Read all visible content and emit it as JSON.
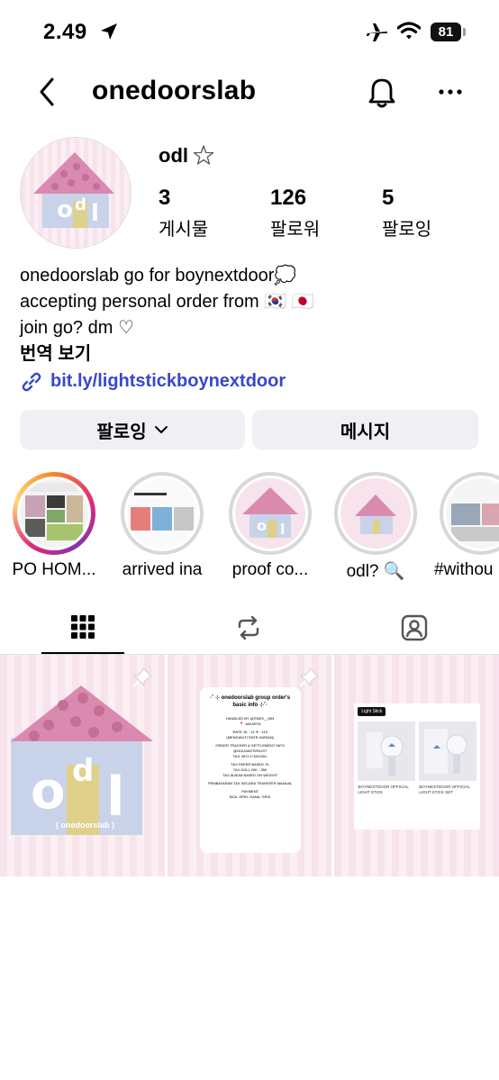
{
  "status_bar": {
    "time": "2.49",
    "battery": "81"
  },
  "header": {
    "username": "onedoorslab"
  },
  "profile": {
    "display_name": "odl",
    "stats": [
      {
        "value": "3",
        "label": "게시물"
      },
      {
        "value": "126",
        "label": "팔로워"
      },
      {
        "value": "5",
        "label": "팔로잉"
      }
    ],
    "bio_lines": [
      "onedoorslab go for boynextdoor💭",
      "accepting personal order from 🇰🇷 🇯🇵",
      "join go? dm ♡"
    ],
    "translate_label": "번역 보기",
    "link": "bit.ly/lightstickboynextdoor"
  },
  "actions": {
    "follow_label": "팔로잉",
    "message_label": "메시지"
  },
  "highlights": [
    {
      "label": "PO HOM..."
    },
    {
      "label": "arrived ina"
    },
    {
      "label": "proof co..."
    },
    {
      "label": "odl? 🔍"
    },
    {
      "label": "#withou"
    }
  ],
  "posts": {
    "logo_caption": "( onedoorslab )",
    "logo_text": "odl",
    "info_post": {
      "title": "·˚ ⊹ onedoorslab group order's basic info ⊹˚·",
      "lines": [
        "HANDLED BY @ITAES__INN",
        "📍 JAKARTA",
        "RATE 1K : 12 ✈ : 115",
        "(MENGIKUTI RATE HARIAN)",
        "ORDER TRACKER & SETTLEMENT INFO",
        "@ODLMASTERLIST",
        "TAX: BIT.LY/TAXODL",
        "TAX PAPER BASED 7K",
        "TAX DOLL 20K - 35K",
        "TAX ALBUM BASED ON WEIGHT",
        "PEMBAYARAN TAX SECARA TRANSFER MANUAL",
        "PAYMENT",
        "BCA, SPAY, DANA, GRIS"
      ]
    },
    "product_post": {
      "tag": "Light Stick",
      "items": [
        "BOYNEXTDOOR OFFICIAL LIGHT STICK",
        "BOYNEXTDOOR OFFICIAL LIGHT STICK SET"
      ]
    }
  },
  "colors": {
    "link": "#3847c9",
    "button_bg": "#efeff4",
    "roof_pink": "#d98aae",
    "house_blue": "#c8d3ea",
    "door_yellow": "#dfd08a"
  }
}
